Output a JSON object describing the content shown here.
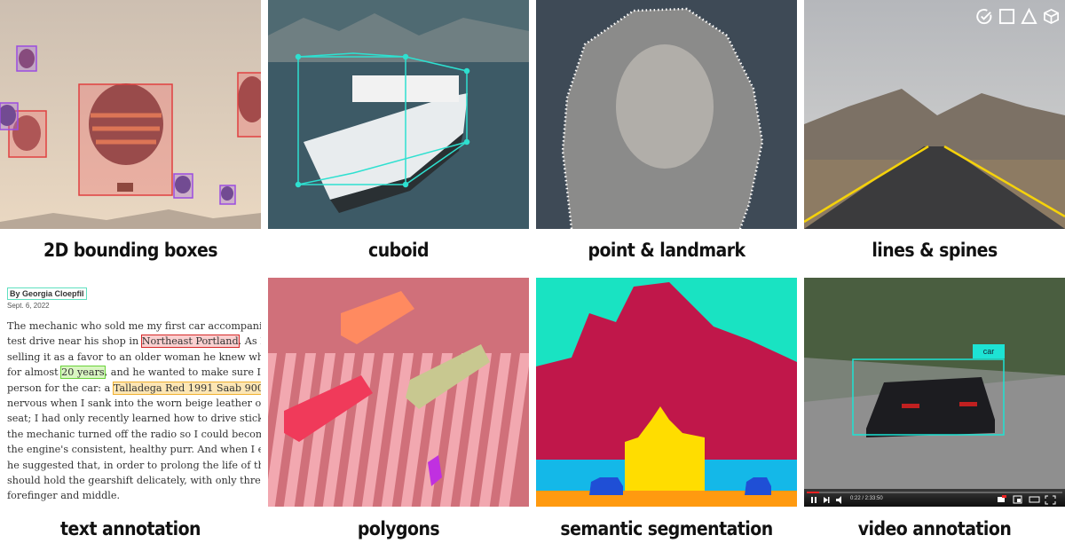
{
  "toolbar": {
    "icons": [
      "check-circle-icon",
      "square-icon",
      "triangle-icon",
      "cube-icon"
    ]
  },
  "tiles": [
    {
      "caption": "2D bounding boxes"
    },
    {
      "caption": "cuboid"
    },
    {
      "caption": "point & landmark"
    },
    {
      "caption": "lines & spines"
    },
    {
      "caption": "text annotation"
    },
    {
      "caption": "polygons"
    },
    {
      "caption": "semantic segmentation"
    },
    {
      "caption": "video annotation"
    }
  ],
  "text_annotation": {
    "author": "By Georgia Cloepfil",
    "date": "Sept. 6, 2022",
    "lines": [
      [
        "The mechanic who sold me my first car accompanied n"
      ],
      [
        "test drive near his shop in ",
        "Northeast Portland",
        ". As I rec"
      ],
      [
        "selling it as a favor to an older woman he knew who ha"
      ],
      [
        "for almost ",
        "20 years",
        ", and he wanted to make sure I was"
      ],
      [
        "person for the car: a ",
        "Talladega Red 1991 Saab 900",
        ". I felt"
      ],
      [
        "nervous when I sank into the worn beige leather of the"
      ],
      [
        "seat; I had only recently learned how to drive stick. Wl"
      ],
      [
        "the mechanic turned off the radio so I could become fa"
      ],
      [
        "the engine's consistent, healthy purr. And when I eased"
      ],
      [
        "he suggested that, in order to prolong the life of the tra"
      ],
      [
        "should hold the gearshift delicately, with only three fin"
      ],
      [
        "forefinger and middle."
      ]
    ],
    "colors": {
      "location": "#d62a2a",
      "duration": "#6ad33a",
      "vehicle": "#f0b030",
      "author": "#5fe0c0"
    }
  },
  "video_annotation": {
    "label": "car",
    "time": "0:22 / 2:33:50",
    "progress": 0.05
  },
  "segmentation": {
    "colors": {
      "sky": "#19e3c2",
      "mountain": "#c0174a",
      "building": "#ffdd00",
      "water": "#14b8e8",
      "car": "#1f4fd6",
      "ground": "#ff9a10"
    }
  }
}
